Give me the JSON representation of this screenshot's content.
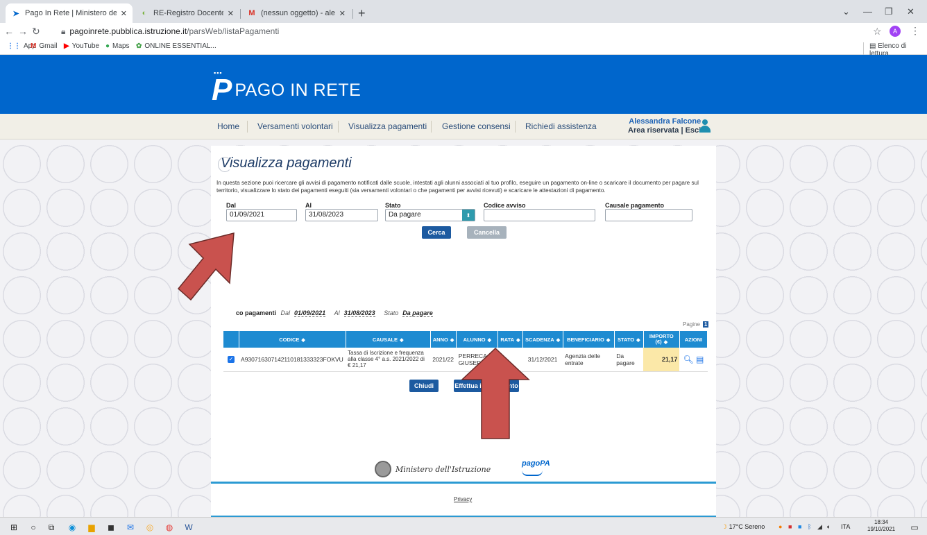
{
  "browser": {
    "tabs": [
      {
        "title": "Pago In Rete | Ministero dell'Istru",
        "icon": "pagoinrete-tab-icon"
      },
      {
        "title": "RE-Registro Docente Programma",
        "icon": "registro-tab-icon"
      },
      {
        "title": "(nessun oggetto) - alessandra.fal",
        "icon": "gmail-tab-icon"
      }
    ],
    "url_host": "pagoinrete.pubblica.istruzione.it",
    "url_path": "/parsWeb/listaPagamenti",
    "profile_initial": "A",
    "bookmarks": [
      "App",
      "Gmail",
      "YouTube",
      "Maps",
      "ONLINE ESSENTIAL..."
    ],
    "reading_list": "Elenco di lettura"
  },
  "site": {
    "brand": "PAGO IN RETE",
    "nav": [
      "Home",
      "Versamenti volontari",
      "Visualizza pagamenti",
      "Gestione consensi",
      "Richiedi assistenza"
    ],
    "user_name": "Alessandra Falcone",
    "user_links": "Area riservata | Esci"
  },
  "main": {
    "title": "Visualizza pagamenti",
    "intro": "In questa sezione puoi ricercare gli avvisi di pagamento notificati dalle scuole, intestati agli alunni associati al tuo profilo, eseguire un pagamento on-line o scaricare il documento per pagare sul territorio, visualizzare lo stato dei pagamenti eseguiti (sia versamenti volontari o che pagamenti per avvisi ricevuti) e scaricare le attestazioni di pagamento.",
    "form": {
      "dal_label": "Dal",
      "dal_value": "01/09/2021",
      "al_label": "Al",
      "al_value": "31/08/2023",
      "stato_label": "Stato",
      "stato_value": "Da pagare",
      "codice_label": "Codice avviso",
      "codice_value": "",
      "causale_label": "Causale pagamento",
      "causale_value": "",
      "search_btn": "Cerca",
      "cancel_btn": "Cancella"
    },
    "filter": {
      "prefix": "co pagamenti",
      "dal_label": "Dal",
      "dal_value": "01/09/2021",
      "al_label": "Al",
      "al_value": "31/08/2023",
      "stato_label": "Stato",
      "stato_value": "Da pagare"
    },
    "pagine_label": "Pagine",
    "pagine_value": "1",
    "table": {
      "headers": [
        "CODICE",
        "CAUSALE",
        "ANNO",
        "ALUNNO",
        "RATA",
        "SCADENZA",
        "BENEFICIARIO",
        "STATO",
        "IMPORTO (€)",
        "AZIONI"
      ],
      "rows": [
        {
          "codice": "A930716307142110181333323FOKVU",
          "causale": "Tassa di Iscrizione e frequenza alla classe 4° a.s. 2021/2022 di € 21,17",
          "anno": "2021/22",
          "alunno": "PERRECA GIUSEPPE",
          "rata": "1",
          "scadenza": "31/12/2021",
          "beneficiario": "Agenzia delle entrate",
          "stato": "Da pagare",
          "importo": "21,17"
        }
      ]
    },
    "close_btn": "Chiudi",
    "pay_btn": "Effettua il pagamento",
    "ministero": "Ministero dell'Istruzione",
    "pagopa": "pagoPA",
    "privacy": "Privacy"
  },
  "taskbar": {
    "weather": "17°C  Sereno",
    "lang": "ITA",
    "time": "18:34",
    "date": "19/10/2021"
  },
  "colors": {
    "header_blue": "#0066cc",
    "table_header": "#1e8bd1",
    "button_blue": "#1c5aa0",
    "arrow_red": "#c9524e",
    "importo_highlight": "#fbe8a8"
  }
}
